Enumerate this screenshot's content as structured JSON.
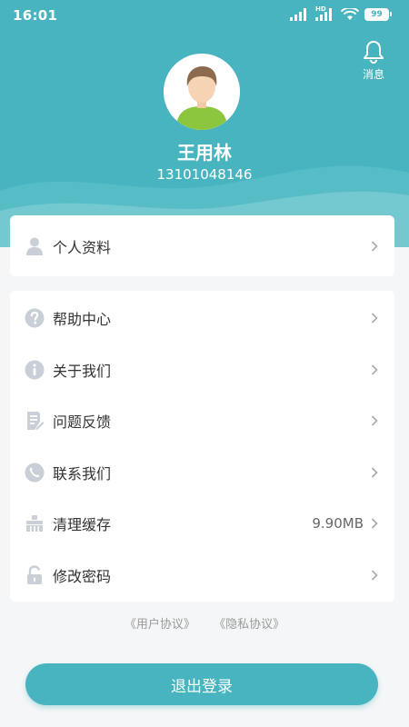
{
  "status": {
    "time": "16:01",
    "network": "HD",
    "battery": "99"
  },
  "header": {
    "message_label": "消息",
    "user_name": "王用林",
    "phone": "13101048146"
  },
  "profile_card": {
    "label": "个人资料"
  },
  "menu": [
    {
      "key": "help",
      "label": "帮助中心",
      "value": ""
    },
    {
      "key": "about",
      "label": "关于我们",
      "value": ""
    },
    {
      "key": "feedback",
      "label": "问题反馈",
      "value": ""
    },
    {
      "key": "contact",
      "label": "联系我们",
      "value": ""
    },
    {
      "key": "cache",
      "label": "清理缓存",
      "value": "9.90MB"
    },
    {
      "key": "password",
      "label": "修改密码",
      "value": ""
    }
  ],
  "agreements": {
    "user": "《用户协议》",
    "privacy": "《隐私协议》"
  },
  "logout_label": "退出登录",
  "colors": {
    "accent": "#48b4bf",
    "icon": "#c9cfd6",
    "text": "#333333"
  }
}
